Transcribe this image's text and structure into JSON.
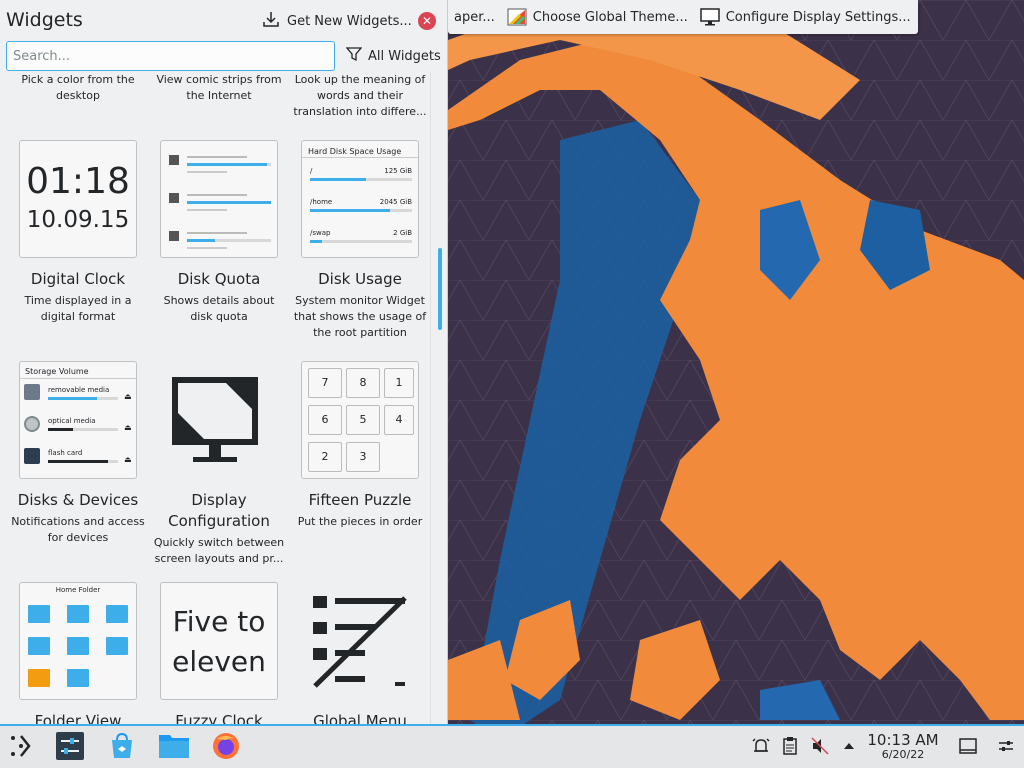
{
  "topbar": {
    "items": [
      {
        "label": "aper...",
        "icon": "wallpaper-icon"
      },
      {
        "label": "Choose Global Theme...",
        "icon": "theme-icon"
      },
      {
        "label": "Configure Display Settings...",
        "icon": "display-icon"
      }
    ],
    "close_label": "✕"
  },
  "panel": {
    "title": "Widgets",
    "get_new_label": "Get New Widgets...",
    "close_label": "✕",
    "search_placeholder": "Search...",
    "filter_label": "All Widgets"
  },
  "widgets": [
    {
      "name": "",
      "desc": "Pick a color from the desktop"
    },
    {
      "name": "",
      "desc": "View comic strips from the Internet"
    },
    {
      "name": "",
      "desc": "Look up the meaning of words and their translation into differe..."
    },
    {
      "name": "Digital Clock",
      "desc": "Time displayed in a digital format",
      "thumb": {
        "time": "01:18",
        "date": "10.09.15"
      }
    },
    {
      "name": "Disk Quota",
      "desc": "Shows details about disk quota"
    },
    {
      "name": "Disk Usage",
      "desc": "System monitor Widget that shows the usage of the root partition",
      "thumb": {
        "title": "Hard Disk Space Usage",
        "rows": [
          {
            "path": "/",
            "size": "125 GiB",
            "fill": 0.55
          },
          {
            "path": "/home",
            "size": "2045 GiB",
            "fill": 0.78
          },
          {
            "path": "/swap",
            "size": "2 GiB",
            "fill": 0.12
          }
        ]
      }
    },
    {
      "name": "Disks & Devices",
      "desc": "Notifications and access for devices",
      "thumb": {
        "title": "Storage Volume",
        "rows": [
          {
            "label": "removable media",
            "fill": 0.7
          },
          {
            "label": "optical media",
            "fill": 0.35
          },
          {
            "label": "flash card",
            "fill": 0.85
          }
        ]
      }
    },
    {
      "name": "Display Configuration",
      "desc": "Quickly switch between screen layouts and pr..."
    },
    {
      "name": "Fifteen Puzzle",
      "desc": "Put the pieces in order",
      "thumb": {
        "tiles": [
          "7",
          "8",
          "1",
          "6",
          "5",
          "4",
          "2",
          "3"
        ]
      }
    },
    {
      "name": "Folder View",
      "desc": "",
      "thumb": {
        "title": "Home Folder"
      }
    },
    {
      "name": "Fuzzy Clock",
      "desc": "",
      "thumb": {
        "text_line1": "Five to",
        "text_line2": "eleven"
      }
    },
    {
      "name": "Global Menu",
      "desc": ""
    }
  ],
  "taskbar": {
    "time": "10:13 AM",
    "date": "6/20/22",
    "apps": [
      "application-launcher-icon",
      "system-settings-icon",
      "discover-icon",
      "file-manager-icon",
      "firefox-icon"
    ],
    "tray": [
      "notifications-icon",
      "clipboard-icon",
      "volume-muted-icon",
      "tray-expand-icon",
      "show-desktop-icon",
      "panel-configure-icon"
    ]
  },
  "colors": {
    "accent": "#3daee9",
    "close": "#da4453",
    "panel_bg": "#eff0f1",
    "wallpaper_orange": "#f28a3c",
    "wallpaper_blue": "#1d5fa0"
  }
}
